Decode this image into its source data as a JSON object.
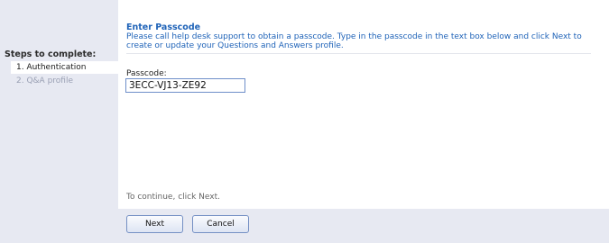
{
  "sidebar": {
    "title": "Steps to complete:",
    "steps": [
      {
        "label": "1. Authentication"
      },
      {
        "label": "2. Q&A profile"
      }
    ]
  },
  "main": {
    "heading": "Enter Passcode",
    "description": "Please call help desk support to obtain a passcode. Type in the passcode in the text box below and click Next to create or update your Questions and Answers profile.",
    "passcode_label": "Passcode:",
    "passcode_value": "3ECC-VJ13-ZE92",
    "footer_text": "To continue, click Next."
  },
  "buttons": {
    "next_label": "Next",
    "cancel_label": "Cancel"
  }
}
